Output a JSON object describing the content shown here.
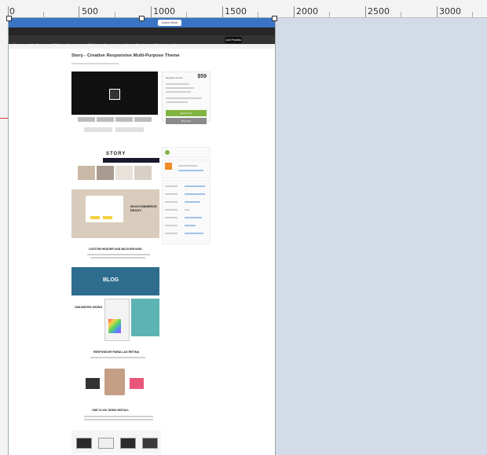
{
  "ruler": {
    "labels": [
      "0",
      "500",
      "1000",
      "1500",
      "2000",
      "2500",
      "3000"
    ]
  },
  "banner": {
    "button_label": "Learn More"
  },
  "nav": {
    "items": [
      "Envato",
      "WordPress",
      "HTML",
      "Marketing",
      "CMS",
      "eCommerce",
      "UI",
      "Blogging",
      "Plugins",
      "More"
    ]
  },
  "tooltip": "Live Preview",
  "product": {
    "title": "Story - Creative Responsive Multi-Purpose Theme",
    "price": "$59",
    "license_label": "Regular License",
    "buy_label": "Add to Cart",
    "preview_label": "Buy Now"
  },
  "sections": {
    "story_word": "STORY",
    "woo_title": "WOOCOMMERCE READY",
    "custom_header": "CUSTOM HEADER AND BACKGROUND",
    "blog_word": "BLOG",
    "skins_label": "UNLIMITED SKINS",
    "responsive": "RESPONSIVE PARALLAX RETINA",
    "one_click": "ONE CLICK DEMO INSTALL"
  },
  "colors": {
    "accent_green": "#82b440",
    "banner_blue": "#3a74c4",
    "canvas_bg": "#d3dbe8"
  }
}
